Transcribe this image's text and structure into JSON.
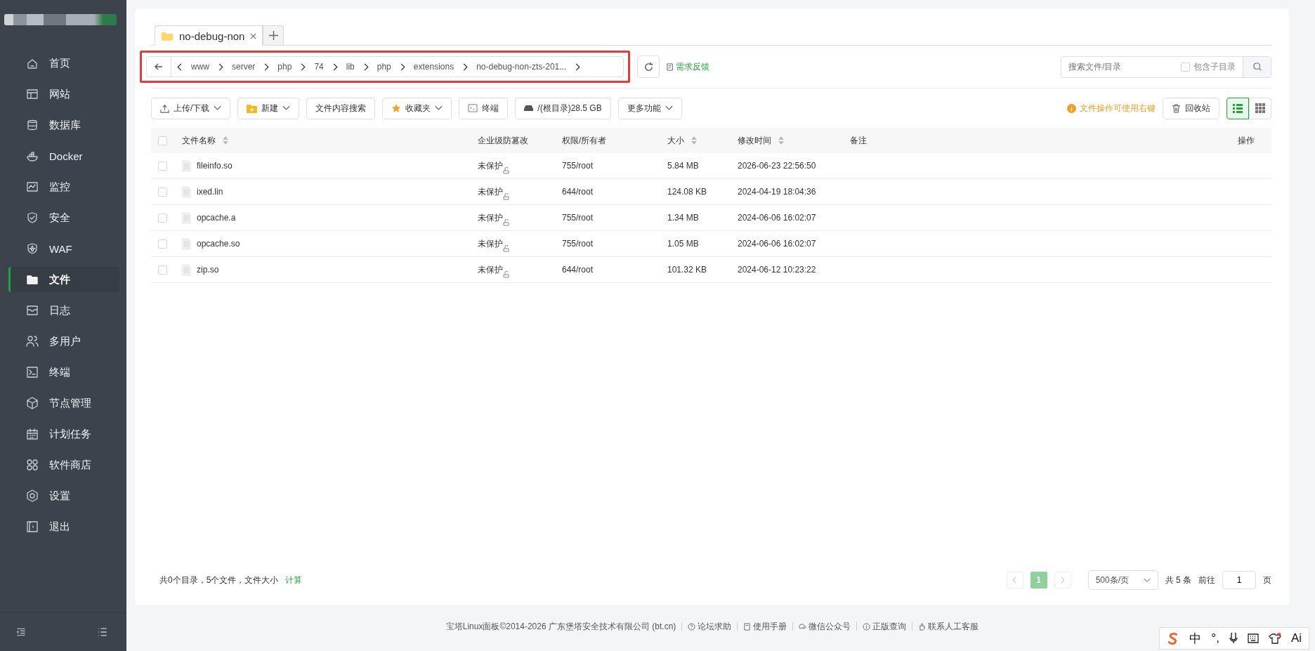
{
  "sidebar": {
    "items": [
      {
        "label": "首页",
        "selected": false
      },
      {
        "label": "网站",
        "selected": false
      },
      {
        "label": "数据库",
        "selected": false
      },
      {
        "label": "Docker",
        "selected": false
      },
      {
        "label": "监控",
        "selected": false
      },
      {
        "label": "安全",
        "selected": false
      },
      {
        "label": "WAF",
        "selected": false
      },
      {
        "label": "文件",
        "selected": true
      },
      {
        "label": "日志",
        "selected": false
      },
      {
        "label": "多用户",
        "selected": false
      },
      {
        "label": "终端",
        "selected": false
      },
      {
        "label": "节点管理",
        "selected": false
      },
      {
        "label": "计划任务",
        "selected": false
      },
      {
        "label": "软件商店",
        "selected": false
      },
      {
        "label": "设置",
        "selected": false
      },
      {
        "label": "退出",
        "selected": false
      }
    ]
  },
  "tabs": [
    {
      "label": "no-debug-non",
      "selected": true
    }
  ],
  "breadcrumb": {
    "segments": [
      "www",
      "server",
      "php",
      "74",
      "lib",
      "php",
      "extensions",
      "no-debug-non-zts-201..."
    ]
  },
  "feedback_link": "需求反馈",
  "search": {
    "placeholder": "搜索文件/目录",
    "include_subdirs": {
      "label": "包含子目录",
      "checked": false
    }
  },
  "toolbar": [
    {
      "label": "上传/下载",
      "kind": "upload",
      "dropdown": true
    },
    {
      "label": "新建",
      "kind": "new",
      "dropdown": true
    },
    {
      "label": "文件内容搜索",
      "kind": "plain",
      "dropdown": false
    },
    {
      "label": "收藏夹",
      "kind": "favorites",
      "dropdown": true
    },
    {
      "label": "终端",
      "kind": "terminal",
      "dropdown": false
    },
    {
      "label": "/(根目录)28.5 GB",
      "kind": "disk",
      "dropdown": false
    },
    {
      "label": "更多功能",
      "kind": "plain",
      "dropdown": true
    }
  ],
  "hint": "文件操作可使用右键",
  "recycle_bin": "回收站",
  "view_modes": [
    {
      "kind": "list",
      "selected": true
    },
    {
      "kind": "grid",
      "selected": false
    }
  ],
  "table": {
    "select_all_checked": false,
    "columns": [
      {
        "label": "文件名称",
        "sortable": true
      },
      {
        "label": "企业级防篡改",
        "sortable": false
      },
      {
        "label": "权限/所有者",
        "sortable": false
      },
      {
        "label": "大小",
        "sortable": true
      },
      {
        "label": "修改时间",
        "sortable": true
      },
      {
        "label": "备注",
        "sortable": false
      },
      {
        "label": "操作",
        "sortable": false
      }
    ],
    "rows": [
      {
        "checked": false,
        "name": "fileinfo.so",
        "protection": "未保护",
        "permission": "755/root",
        "size": "5.84 MB",
        "modified": "2026-06-23 22:56:50"
      },
      {
        "checked": false,
        "name": "ixed.lin",
        "protection": "未保护",
        "permission": "644/root",
        "size": "124.08 KB",
        "modified": "2024-04-19 18:04:36"
      },
      {
        "checked": false,
        "name": "opcache.a",
        "protection": "未保护",
        "permission": "755/root",
        "size": "1.34 MB",
        "modified": "2024-06-06 16:02:07"
      },
      {
        "checked": false,
        "name": "opcache.so",
        "protection": "未保护",
        "permission": "755/root",
        "size": "1.05 MB",
        "modified": "2024-06-06 16:02:07"
      },
      {
        "checked": false,
        "name": "zip.so",
        "protection": "未保护",
        "permission": "644/root",
        "size": "101.32 KB",
        "modified": "2024-06-12 10:23:22"
      }
    ]
  },
  "summary": {
    "text": "共0个目录，5个文件，文件大小",
    "action": "计算"
  },
  "pagination": {
    "pages": [
      {
        "label": "1",
        "selected": true
      }
    ],
    "page_size": "500条/页",
    "total": "共 5 条",
    "goto": "前往",
    "goto_value": "1",
    "page_unit": "页"
  },
  "footer": {
    "copyright": "宝塔Linux面板©2014-2026 广东堡塔安全技术有限公司 (bt.cn)",
    "links": [
      {
        "label": "论坛求助",
        "kind": "help"
      },
      {
        "label": "使用手册",
        "kind": "book"
      },
      {
        "label": "微信公众号",
        "kind": "wechat"
      },
      {
        "label": "正版查询",
        "kind": "info"
      },
      {
        "label": "联系人工客服",
        "kind": "support"
      }
    ]
  },
  "ime_toolbar": {
    "items": [
      "中",
      "°,",
      "Ai"
    ]
  }
}
